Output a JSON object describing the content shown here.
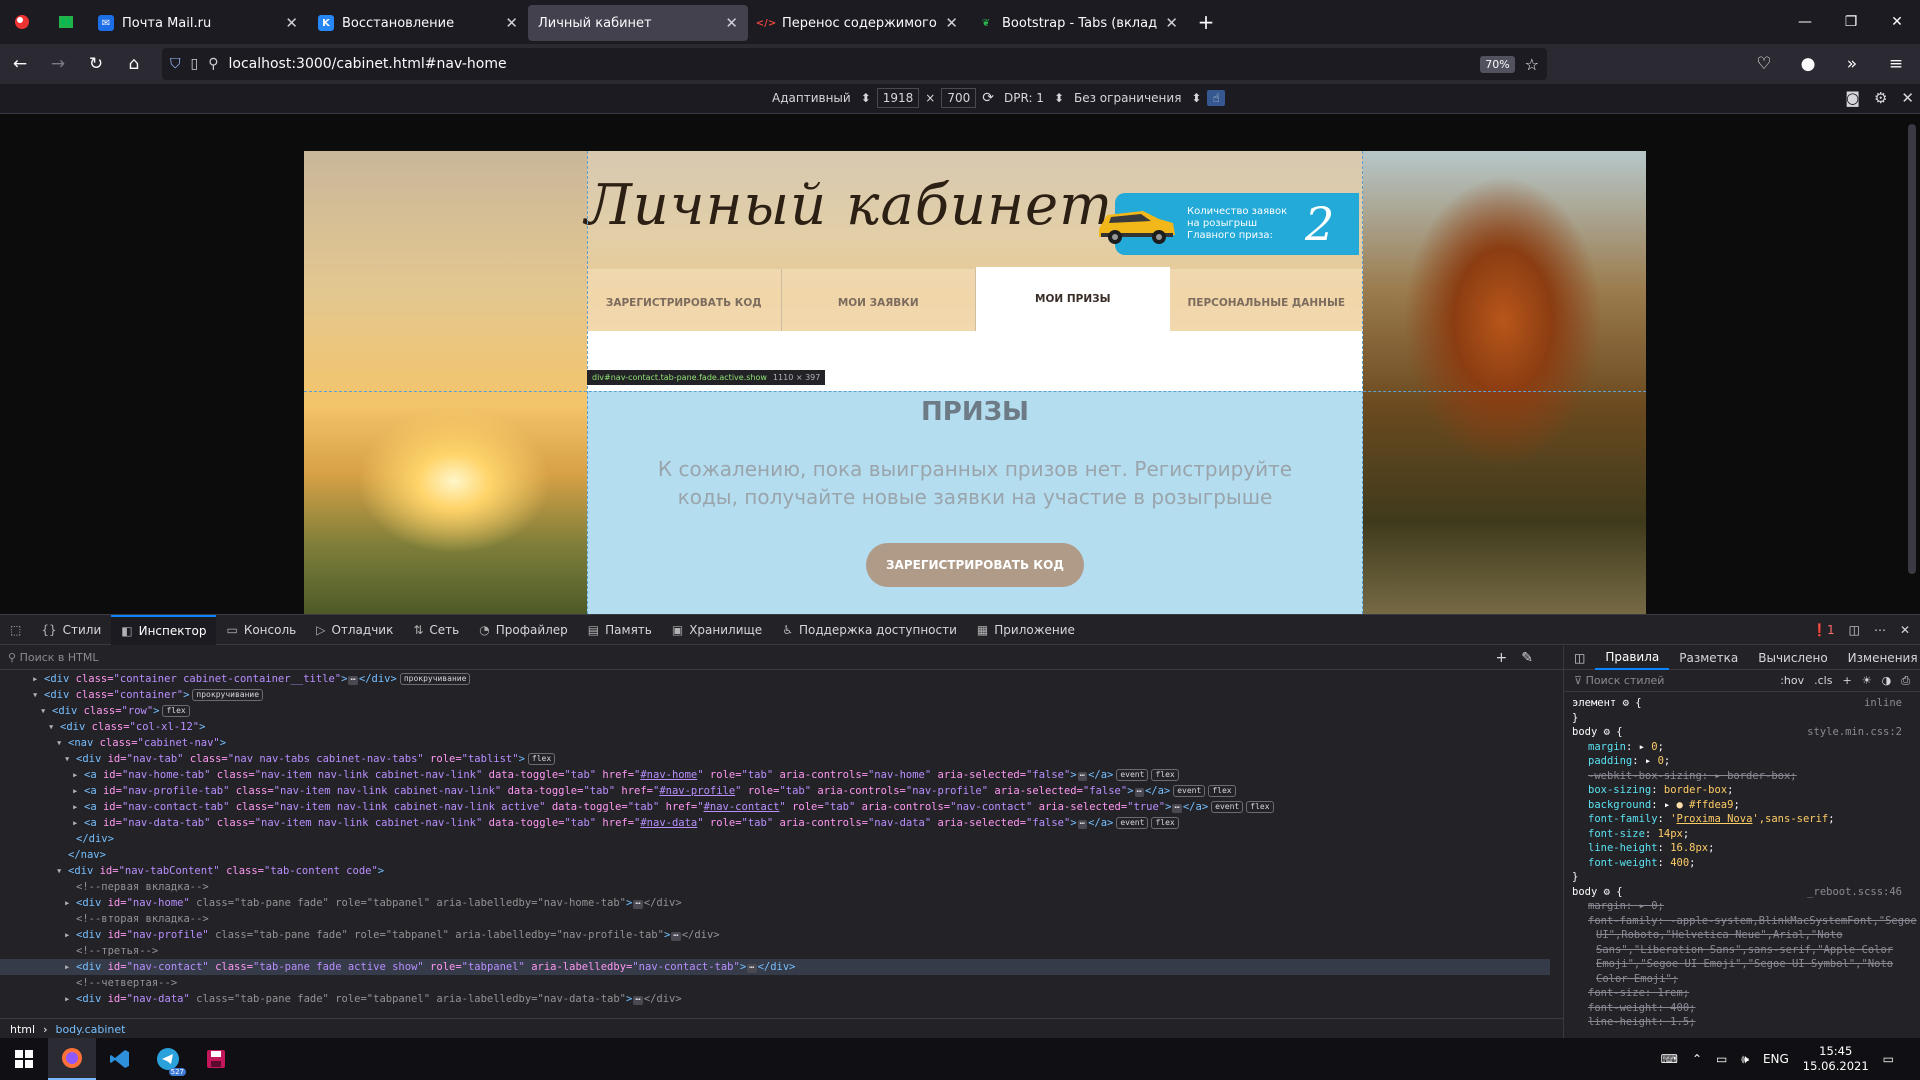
{
  "browser": {
    "tabs": [
      {
        "title": "Почта Mail.ru",
        "fav": "mail-icon",
        "fav_color": "#1d6fe8",
        "active": false
      },
      {
        "title": "Восстановление",
        "fav": "vk-icon",
        "fav_color": "#2787f5",
        "active": false
      },
      {
        "title": "Личный кабинет",
        "fav": "",
        "fav_color": "",
        "active": true
      },
      {
        "title": "Перенос содержимого из одн",
        "fav": "code-icon",
        "fav_color": "#e8463b",
        "active": false
      },
      {
        "title": "Bootstrap - Tabs (вкладки) - ИТ",
        "fav": "leaf-icon",
        "fav_color": "#2bb24c",
        "active": false
      }
    ],
    "url": "localhost:3000/cabinet.html#nav-home",
    "zoom": "70%"
  },
  "rdm": {
    "device": "Адаптивный",
    "width": "1918",
    "times": "×",
    "height": "700",
    "dpr": "DPR: 1",
    "throttle": "Без ограничения"
  },
  "site": {
    "title": "Личный кабинет",
    "prize_text": "Количество заявок на розыгрыш Главного приза:",
    "prize_count": "2",
    "tabs": [
      "ЗАРЕГИСТРИРОВАТЬ КОД",
      "МОИ ЗАЯВКИ",
      "МОИ ПРИЗЫ",
      "ПЕРСОНАЛЬНЫЕ ДАННЫЕ"
    ],
    "active_tab": 2,
    "tooltip_selector": "div#nav-contact.tab-pane.fade.active.show",
    "tooltip_size": "1110 × 397",
    "prizes_heading": "ПРИЗЫ",
    "prizes_message": "К сожалению, пока выигранных призов нет. Регистрируйте коды, получайте новые заявки на участие в розыгрыше",
    "button": "ЗАРЕГИСТРИРОВАТЬ КОД"
  },
  "devtools": {
    "tabs": [
      "Стили",
      "Инспектор",
      "Консоль",
      "Отладчик",
      "Сеть",
      "Профайлер",
      "Память",
      "Хранилище",
      "Поддержка доступности",
      "Приложение"
    ],
    "active_tab": "Инспектор",
    "error_count": "1",
    "search_placeholder": "Поиск в HTML",
    "rules_tabs": [
      "Правила",
      "Разметка",
      "Вычислено",
      "Изменения"
    ],
    "rules_filter_placeholder": "Поиск стилей",
    "hov": ":hov",
    "cls": ".cls",
    "breadcrumb": [
      "html",
      "body.cabinet"
    ]
  },
  "rules": {
    "element_label": "элемент",
    "element_src": "inline",
    "body1_src": "style.min.css:2",
    "body2_src": "_reboot.scss:46"
  },
  "taskbar": {
    "lang": "ENG",
    "time": "15:45",
    "date": "15.06.2021",
    "telegram_badge": "527"
  }
}
